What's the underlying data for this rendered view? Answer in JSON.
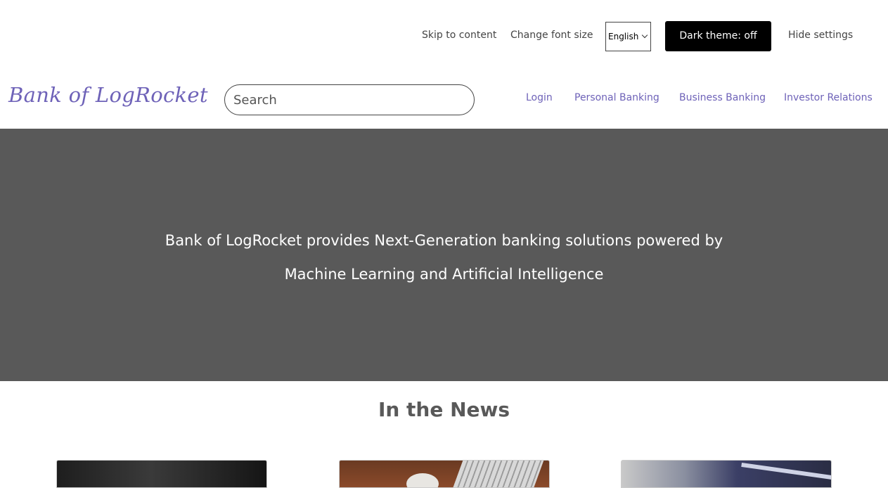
{
  "settings": {
    "skip_label": "Skip to content",
    "font_size_label": "Change font size",
    "language_selected": "English",
    "dark_theme_label": "Dark theme: off",
    "hide_settings_label": "Hide settings"
  },
  "header": {
    "logo_text": "Bank of LogRocket",
    "search_placeholder": "Search",
    "nav": {
      "login": "Login",
      "personal": "Personal Banking",
      "business": "Business Banking",
      "investor": "Investor Relations"
    }
  },
  "hero": {
    "text": "Bank of LogRocket provides Next-Generation banking solutions powered by Machine Learning and Artificial Intelligence"
  },
  "news": {
    "heading": "In the News"
  },
  "colors": {
    "brand": "#6e62b8",
    "hero_bg": "#595959",
    "dark_button": "#000000"
  },
  "icons": {
    "language_dropdown": "chevron-down-icon"
  }
}
